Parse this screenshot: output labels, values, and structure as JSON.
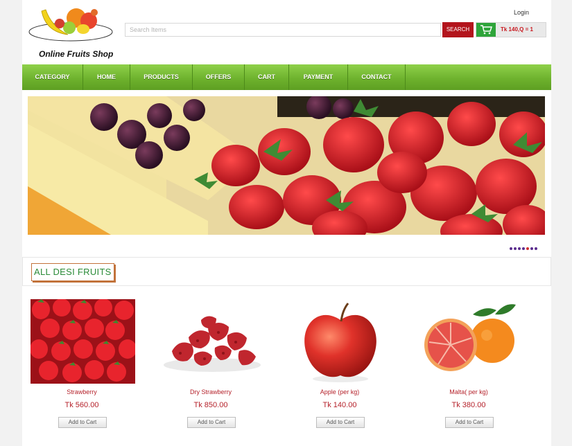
{
  "header": {
    "logo_text": "Online Fruits Shop",
    "login_label": "Login",
    "search": {
      "placeholder": "Search Items",
      "button_label": "SEARCH"
    },
    "cart": {
      "summary": "Tk 140,Q = 1"
    }
  },
  "nav": {
    "items": [
      {
        "label": "CATEGORY"
      },
      {
        "label": "HOME"
      },
      {
        "label": "PRODUCTS"
      },
      {
        "label": "OFFERS"
      },
      {
        "label": "CART"
      },
      {
        "label": "PAYMENT"
      },
      {
        "label": "CONTACT"
      }
    ]
  },
  "slider": {
    "slide_count": 7,
    "active_index": 4
  },
  "section": {
    "title": "ALL DESI FRUITS"
  },
  "products": [
    {
      "name": "Strawberry",
      "price": "Tk 560.00",
      "button": "Add to Cart"
    },
    {
      "name": "Dry Strawberry",
      "price": "Tk 850.00",
      "button": "Add to Cart"
    },
    {
      "name": "Apple (per kg)",
      "price": "Tk 140.00",
      "button": "Add to Cart"
    },
    {
      "name": "Malta( per kg)",
      "price": "Tk 380.00",
      "button": "Add to Cart"
    }
  ],
  "colors": {
    "nav_green": "#6cb02c",
    "search_red": "#b3141c",
    "cart_green": "#2ea43a",
    "price_red": "#b5222b",
    "title_green": "#2a8a36"
  }
}
